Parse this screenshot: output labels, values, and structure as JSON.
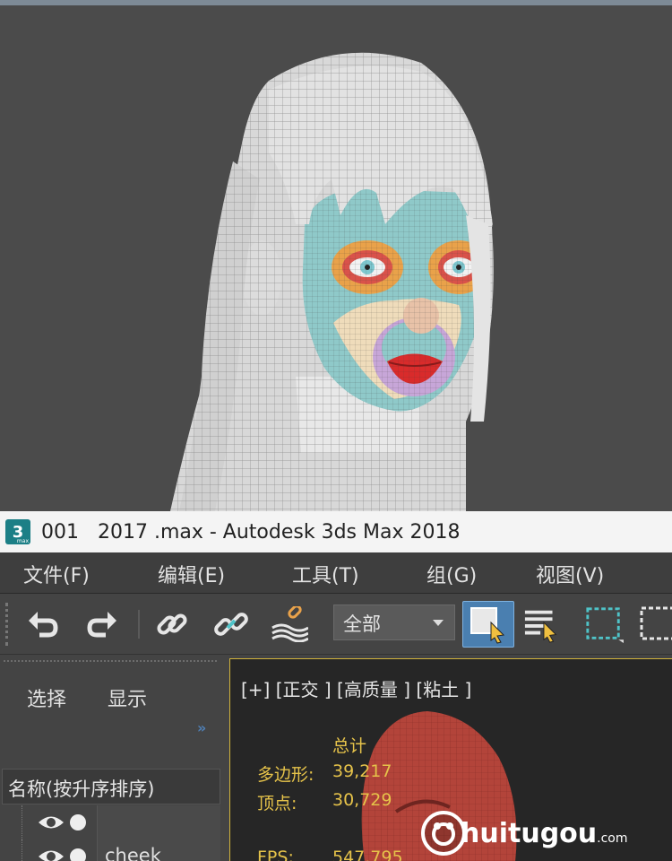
{
  "window": {
    "app_logo": "3",
    "title": "001   2017 .max - Autodesk 3ds Max 2018"
  },
  "menu": {
    "items": [
      "文件(F)",
      "编辑(E)",
      "工具(T)",
      "组(G)",
      "视图(V)"
    ]
  },
  "toolbar": {
    "selection_filter": "全部",
    "icons": [
      "undo-icon",
      "redo-icon",
      "link-icon",
      "unlink-icon",
      "bind-space-warp-icon",
      "select-object-icon",
      "select-by-name-icon",
      "rect-selection-icon",
      "window-crossing-icon"
    ]
  },
  "explorer": {
    "tabs": [
      "选择",
      "显示"
    ],
    "more": "»",
    "column_header": "名称(按升序排序)",
    "rows": [
      {
        "name": ""
      },
      {
        "name": "cheek"
      }
    ]
  },
  "viewport": {
    "label": "[+] [正交 ] [高质量 ] [粘土 ]",
    "stats_header": "总计",
    "stats": [
      {
        "label": "多边形:",
        "value": "39,217"
      },
      {
        "label": "顶点:",
        "value": "30,729"
      },
      {
        "label": "FPS:",
        "value": "547.795"
      }
    ]
  },
  "watermark": {
    "text": "huitugou",
    "suffix": ".com"
  },
  "colors": {
    "accent_blue": "#4a7fb0",
    "stat_yellow": "#e6c34a",
    "viewport_border": "#d2b43c",
    "clay_red": "#b3443a"
  }
}
